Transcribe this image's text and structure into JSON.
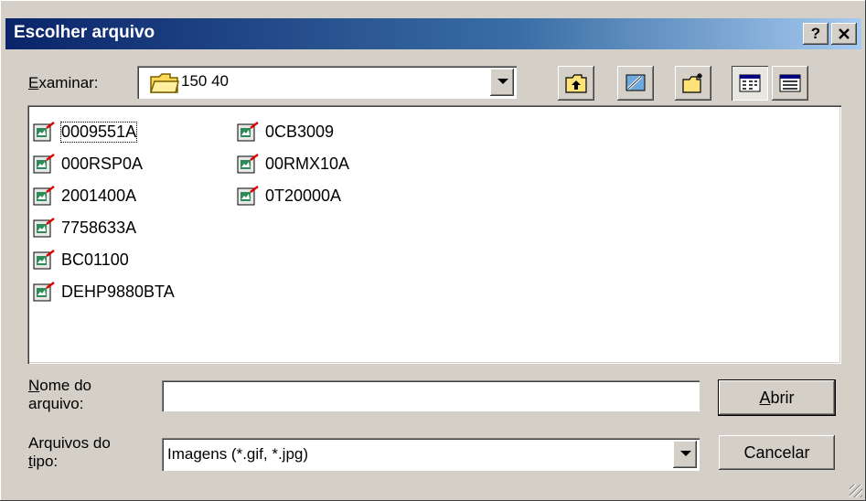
{
  "window": {
    "title": "Escolher arquivo",
    "help_label": "?",
    "close_label": "✕"
  },
  "lookin": {
    "label_first": "E",
    "label_rest": "xaminar:",
    "folder_icon": "folder-icon",
    "value": "150 40"
  },
  "toolbar": [
    {
      "name": "up-one-level-icon"
    },
    {
      "name": "desktop-icon"
    },
    {
      "name": "new-folder-icon"
    },
    {
      "name": "list-view-icon",
      "pressed": true
    },
    {
      "name": "details-view-icon"
    }
  ],
  "files": [
    "0009551A",
    "000RSP0A",
    "2001400A",
    "7758633A",
    "BC01100",
    "DEHP9880BTA",
    "0CB3009",
    "00RMX10A",
    "0T20000A"
  ],
  "filename": {
    "label_line1_first": "N",
    "label_line1_rest": "ome do",
    "label_line2": "arquivo:",
    "value": ""
  },
  "filetype": {
    "label_line1": "Arquivos do",
    "label_line2_first": "t",
    "label_line2_rest": "ipo:",
    "value": "Imagens (*.gif, *.jpg)"
  },
  "buttons": {
    "open_first": "A",
    "open_rest": "brir",
    "cancel": "Cancelar"
  },
  "colors": {
    "title_start": "#0a246a",
    "title_end": "#a6caf0",
    "face": "#d4d0c8"
  }
}
